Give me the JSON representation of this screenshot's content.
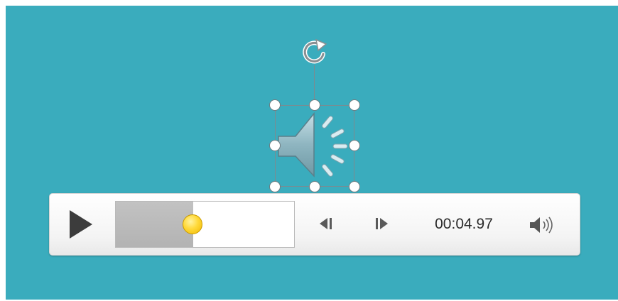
{
  "player": {
    "current_time": "00:04.97",
    "progress_fraction": 0.43
  },
  "icons": {
    "rotate": "rotate-icon",
    "speaker": "speaker-icon",
    "play": "play-icon",
    "skip_back": "skip-back-icon",
    "skip_forward": "skip-forward-icon",
    "volume": "volume-icon"
  },
  "colors": {
    "slide_background": "#3aacbd",
    "progress_fill": "#b8b8b8",
    "thumb": "#ffd93a"
  }
}
